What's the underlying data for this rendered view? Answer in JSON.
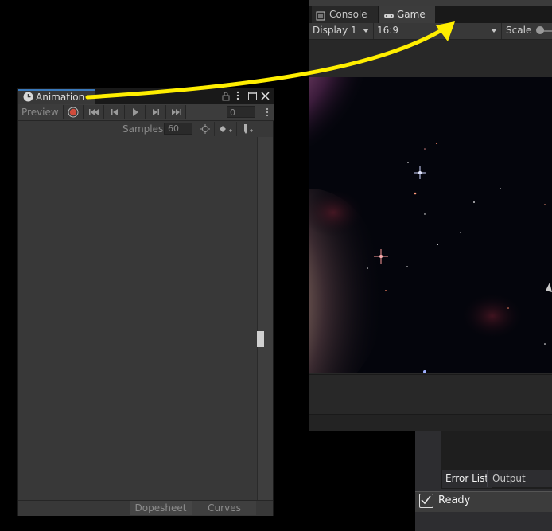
{
  "game_window": {
    "tabs": [
      {
        "label": "Console",
        "icon": "console-icon"
      },
      {
        "label": "Game",
        "icon": "gamepad-icon"
      }
    ],
    "display_select": "Display 1",
    "aspect_select": "16:9",
    "scale_label": "Scale"
  },
  "animation_window": {
    "tab_label": "Animation",
    "tab_icon": "clock-icon",
    "preview_label": "Preview",
    "current_frame": "0",
    "samples_label": "Samples",
    "samples_value": "60",
    "bottom_tabs": {
      "dopesheet": "Dopesheet",
      "curves": "Curves"
    }
  },
  "vs_window": {
    "tabs": {
      "error_list": "Error List",
      "output": "Output"
    },
    "status": "Ready"
  },
  "colors": {
    "arrow": "#ffee00",
    "record": "#d04c3c",
    "active_tab_accent": "#3a79bb",
    "unity_panel": "#383838",
    "vs_status": "#3c3c3c"
  }
}
